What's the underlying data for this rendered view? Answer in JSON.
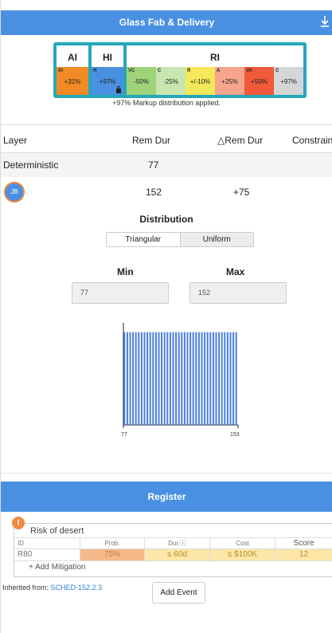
{
  "header": {
    "title": "Glass Fab & Delivery",
    "download_icon": "download-icon"
  },
  "scale": {
    "groups": [
      "AI",
      "HI",
      "RI"
    ],
    "cells": [
      {
        "tag": "AI",
        "value": "+31%",
        "color": "#f08a24"
      },
      {
        "tag": "H",
        "value": "+97%",
        "color": "#4a90e2"
      },
      {
        "tag": "VC",
        "value": "-50%",
        "color": "#9ed37a"
      },
      {
        "tag": "C",
        "value": "-25%",
        "color": "#c8e6b0"
      },
      {
        "tag": "R",
        "value": "+/-10%",
        "color": "#f5e85a"
      },
      {
        "tag": "A",
        "value": "+25%",
        "color": "#f7a58c"
      },
      {
        "tag": "VA",
        "value": "+50%",
        "color": "#ee5a3a"
      },
      {
        "tag": "C",
        "value": "+97%",
        "color": "#d6d6d6"
      }
    ],
    "note": "+97% Markup distribution applied."
  },
  "table": {
    "headers": [
      "Layer",
      "Rem Dur",
      "△Rem Dur",
      "Constrain"
    ],
    "rows": [
      {
        "layer": "Deterministic",
        "rem": "77",
        "delta": ""
      },
      {
        "avatar": "JB",
        "rem": "152",
        "delta": "+75"
      }
    ]
  },
  "distribution": {
    "title": "Distribution",
    "options": [
      "Triangular",
      "Uniform"
    ],
    "selected": "Uniform",
    "min_label": "Min",
    "max_label": "Max",
    "min_value": "77",
    "max_value": "152"
  },
  "chart_data": {
    "type": "bar",
    "title": "",
    "xlabel": "",
    "ylabel": "",
    "x_ticks": [
      "77",
      "153"
    ],
    "xlim": [
      77,
      153
    ],
    "bin_count": 40,
    "bin_values": [
      1,
      1,
      1,
      1,
      1,
      1,
      1,
      1,
      1,
      1,
      1,
      1,
      1,
      1,
      1,
      1,
      1,
      1,
      1,
      1,
      1,
      1,
      1,
      1,
      1,
      1,
      1,
      1,
      1,
      1,
      1,
      1,
      1,
      1,
      1,
      1,
      1,
      1,
      1,
      1
    ],
    "ylim": [
      0,
      1.1
    ],
    "color": "#4a7de0"
  },
  "register": {
    "title": "Register",
    "risk": {
      "title": "Risk of desert",
      "headers": [
        "ID",
        "Prob.",
        "Dur.ⓘ",
        "Cost",
        "Score"
      ],
      "row": {
        "id": "R80",
        "prob": "75%",
        "dur": "≤ 60d",
        "cost": "≤ $100K",
        "score": "12"
      },
      "add_mitigation": "+ Add Mitigation"
    },
    "inherited_label": "Inherited from:",
    "inherited_link": "SCHED-152.2.3",
    "add_event": "Add Event"
  }
}
